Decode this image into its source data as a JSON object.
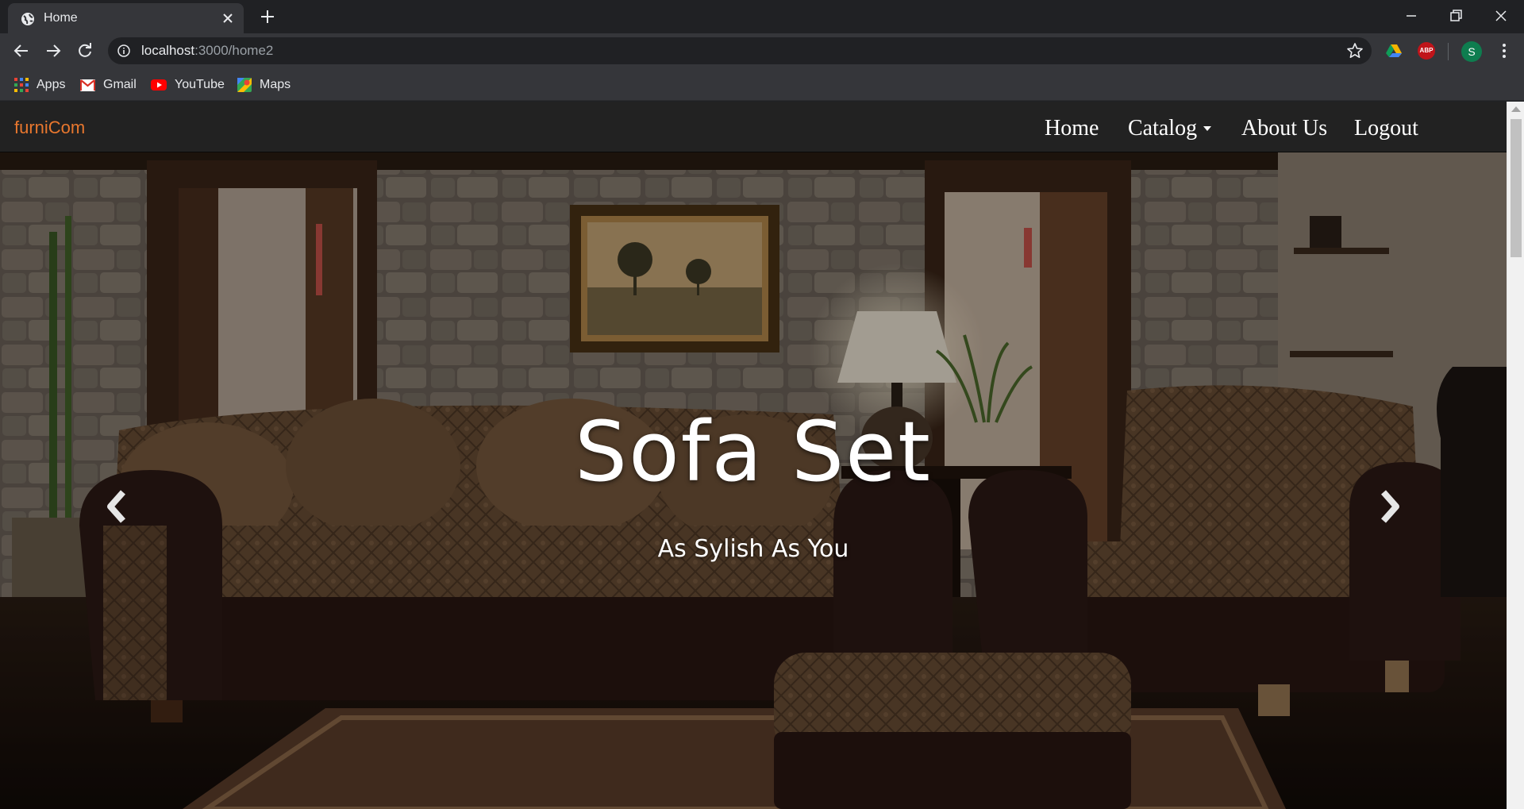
{
  "browser": {
    "tab": {
      "title": "Home",
      "favicon": "globe-icon"
    },
    "url": {
      "host": "localhost",
      "path": ":3000/home2"
    },
    "bookmarks": [
      {
        "label": "Apps",
        "icon": "apps-grid-icon"
      },
      {
        "label": "Gmail",
        "icon": "gmail-icon"
      },
      {
        "label": "YouTube",
        "icon": "youtube-icon"
      },
      {
        "label": "Maps",
        "icon": "maps-icon"
      }
    ],
    "profile_initial": "S",
    "extensions": [
      "drive-extension-icon",
      "adblock-plus-icon"
    ],
    "abp_label": "ABP"
  },
  "navbar": {
    "brand": "furniCom",
    "brand_color": "#e8772e",
    "links": {
      "home": "Home",
      "catalog": "Catalog",
      "about": "About Us",
      "logout": "Logout"
    }
  },
  "carousel": {
    "title": "Sofa Set",
    "subtitle": "As Sylish As You",
    "prev_icon": "chevron-left-icon",
    "next_icon": "chevron-right-icon"
  }
}
